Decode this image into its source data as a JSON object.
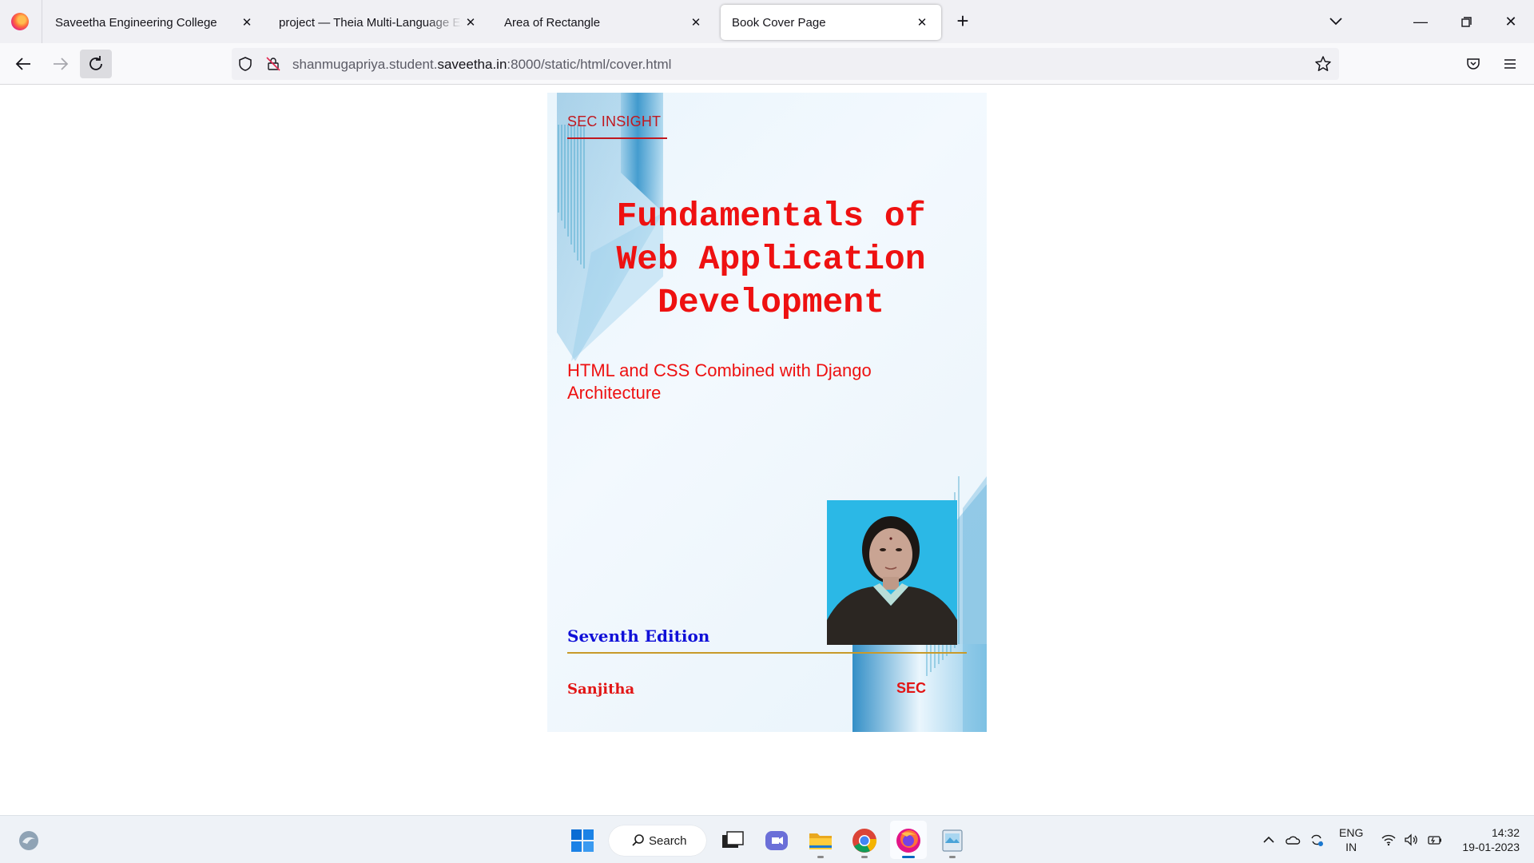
{
  "browser": {
    "tabs": [
      {
        "label": "Saveetha Engineering College",
        "active": false
      },
      {
        "label": "project — Theia Multi-Language Ex",
        "active": false
      },
      {
        "label": "Area of Rectangle",
        "active": false
      },
      {
        "label": "Book Cover Page",
        "active": true
      }
    ],
    "new_tab_label": "+",
    "url_prefix": "shanmugapriya.student.",
    "url_host": "saveetha.in",
    "url_suffix": ":8000/static/html/cover.html",
    "icons": [
      "firefox-icon",
      "back-icon",
      "forward-icon",
      "reload-icon",
      "shield-icon",
      "permissions-icon",
      "bookmark-star-icon",
      "pocket-icon",
      "menu-icon"
    ]
  },
  "cover": {
    "brand": "SEC INSIGHT",
    "title_lines": [
      "Fundamentals of",
      "Web Application",
      "Development"
    ],
    "subtitle": "HTML and CSS Combined with Django Architecture",
    "edition": "Seventh Edition",
    "author": "Sanjitha",
    "publisher": "SEC",
    "colors": {
      "title": "#ee1111",
      "edition": "#1010d8",
      "edition_rule": "#c89a2a",
      "photo_bg": "#29b6e5"
    }
  },
  "taskbar": {
    "search_label": "Search",
    "apps": [
      "windows-start-icon",
      "task-view-icon",
      "teams-chat-icon",
      "file-explorer-icon",
      "chrome-icon",
      "firefox-icon",
      "paint-icon"
    ],
    "language_line1": "ENG",
    "language_line2": "IN",
    "time": "14:32",
    "date": "19-01-2023"
  }
}
